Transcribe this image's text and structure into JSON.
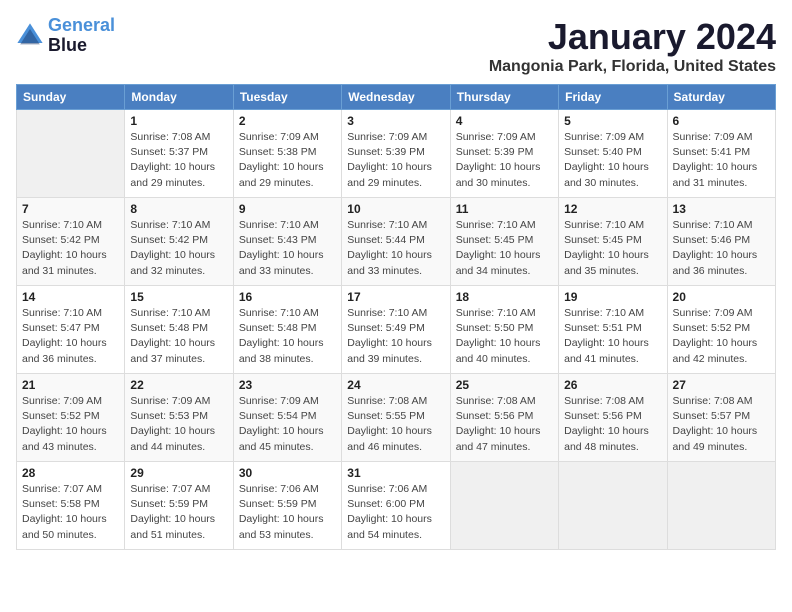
{
  "header": {
    "logo_line1": "General",
    "logo_line2": "Blue",
    "month_title": "January 2024",
    "location": "Mangonia Park, Florida, United States"
  },
  "days_of_week": [
    "Sunday",
    "Monday",
    "Tuesday",
    "Wednesday",
    "Thursday",
    "Friday",
    "Saturday"
  ],
  "weeks": [
    [
      {
        "day": "",
        "detail": ""
      },
      {
        "day": "1",
        "detail": "Sunrise: 7:08 AM\nSunset: 5:37 PM\nDaylight: 10 hours\nand 29 minutes."
      },
      {
        "day": "2",
        "detail": "Sunrise: 7:09 AM\nSunset: 5:38 PM\nDaylight: 10 hours\nand 29 minutes."
      },
      {
        "day": "3",
        "detail": "Sunrise: 7:09 AM\nSunset: 5:39 PM\nDaylight: 10 hours\nand 29 minutes."
      },
      {
        "day": "4",
        "detail": "Sunrise: 7:09 AM\nSunset: 5:39 PM\nDaylight: 10 hours\nand 30 minutes."
      },
      {
        "day": "5",
        "detail": "Sunrise: 7:09 AM\nSunset: 5:40 PM\nDaylight: 10 hours\nand 30 minutes."
      },
      {
        "day": "6",
        "detail": "Sunrise: 7:09 AM\nSunset: 5:41 PM\nDaylight: 10 hours\nand 31 minutes."
      }
    ],
    [
      {
        "day": "7",
        "detail": "Sunrise: 7:10 AM\nSunset: 5:42 PM\nDaylight: 10 hours\nand 31 minutes."
      },
      {
        "day": "8",
        "detail": "Sunrise: 7:10 AM\nSunset: 5:42 PM\nDaylight: 10 hours\nand 32 minutes."
      },
      {
        "day": "9",
        "detail": "Sunrise: 7:10 AM\nSunset: 5:43 PM\nDaylight: 10 hours\nand 33 minutes."
      },
      {
        "day": "10",
        "detail": "Sunrise: 7:10 AM\nSunset: 5:44 PM\nDaylight: 10 hours\nand 33 minutes."
      },
      {
        "day": "11",
        "detail": "Sunrise: 7:10 AM\nSunset: 5:45 PM\nDaylight: 10 hours\nand 34 minutes."
      },
      {
        "day": "12",
        "detail": "Sunrise: 7:10 AM\nSunset: 5:45 PM\nDaylight: 10 hours\nand 35 minutes."
      },
      {
        "day": "13",
        "detail": "Sunrise: 7:10 AM\nSunset: 5:46 PM\nDaylight: 10 hours\nand 36 minutes."
      }
    ],
    [
      {
        "day": "14",
        "detail": "Sunrise: 7:10 AM\nSunset: 5:47 PM\nDaylight: 10 hours\nand 36 minutes."
      },
      {
        "day": "15",
        "detail": "Sunrise: 7:10 AM\nSunset: 5:48 PM\nDaylight: 10 hours\nand 37 minutes."
      },
      {
        "day": "16",
        "detail": "Sunrise: 7:10 AM\nSunset: 5:48 PM\nDaylight: 10 hours\nand 38 minutes."
      },
      {
        "day": "17",
        "detail": "Sunrise: 7:10 AM\nSunset: 5:49 PM\nDaylight: 10 hours\nand 39 minutes."
      },
      {
        "day": "18",
        "detail": "Sunrise: 7:10 AM\nSunset: 5:50 PM\nDaylight: 10 hours\nand 40 minutes."
      },
      {
        "day": "19",
        "detail": "Sunrise: 7:10 AM\nSunset: 5:51 PM\nDaylight: 10 hours\nand 41 minutes."
      },
      {
        "day": "20",
        "detail": "Sunrise: 7:09 AM\nSunset: 5:52 PM\nDaylight: 10 hours\nand 42 minutes."
      }
    ],
    [
      {
        "day": "21",
        "detail": "Sunrise: 7:09 AM\nSunset: 5:52 PM\nDaylight: 10 hours\nand 43 minutes."
      },
      {
        "day": "22",
        "detail": "Sunrise: 7:09 AM\nSunset: 5:53 PM\nDaylight: 10 hours\nand 44 minutes."
      },
      {
        "day": "23",
        "detail": "Sunrise: 7:09 AM\nSunset: 5:54 PM\nDaylight: 10 hours\nand 45 minutes."
      },
      {
        "day": "24",
        "detail": "Sunrise: 7:08 AM\nSunset: 5:55 PM\nDaylight: 10 hours\nand 46 minutes."
      },
      {
        "day": "25",
        "detail": "Sunrise: 7:08 AM\nSunset: 5:56 PM\nDaylight: 10 hours\nand 47 minutes."
      },
      {
        "day": "26",
        "detail": "Sunrise: 7:08 AM\nSunset: 5:56 PM\nDaylight: 10 hours\nand 48 minutes."
      },
      {
        "day": "27",
        "detail": "Sunrise: 7:08 AM\nSunset: 5:57 PM\nDaylight: 10 hours\nand 49 minutes."
      }
    ],
    [
      {
        "day": "28",
        "detail": "Sunrise: 7:07 AM\nSunset: 5:58 PM\nDaylight: 10 hours\nand 50 minutes."
      },
      {
        "day": "29",
        "detail": "Sunrise: 7:07 AM\nSunset: 5:59 PM\nDaylight: 10 hours\nand 51 minutes."
      },
      {
        "day": "30",
        "detail": "Sunrise: 7:06 AM\nSunset: 5:59 PM\nDaylight: 10 hours\nand 53 minutes."
      },
      {
        "day": "31",
        "detail": "Sunrise: 7:06 AM\nSunset: 6:00 PM\nDaylight: 10 hours\nand 54 minutes."
      },
      {
        "day": "",
        "detail": ""
      },
      {
        "day": "",
        "detail": ""
      },
      {
        "day": "",
        "detail": ""
      }
    ]
  ]
}
